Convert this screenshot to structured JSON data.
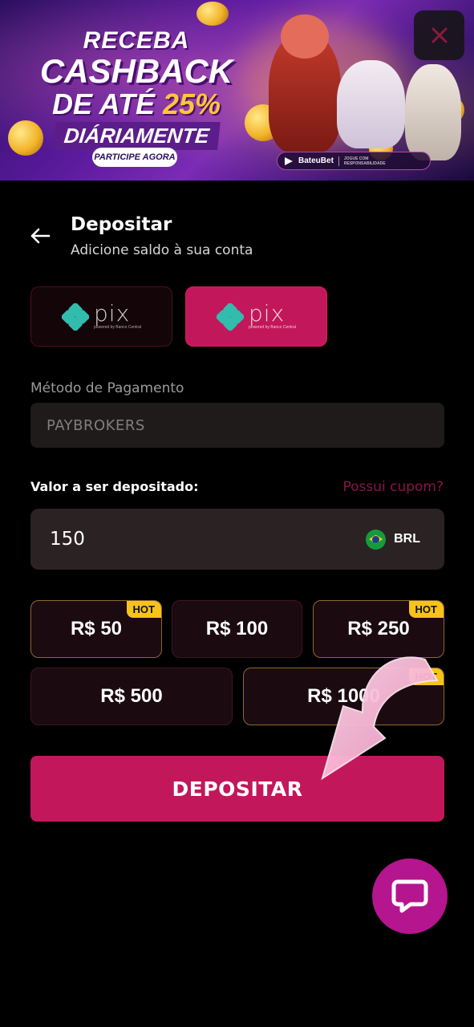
{
  "banner": {
    "line1": "RECEBA",
    "line2": "CASHBACK",
    "line3_prefix": "DE ATÉ ",
    "line3_highlight": "25%",
    "line4": "DIÁRIAMENTE",
    "cta": "PARTICIPE AGORA",
    "brand": "BateuBet",
    "disclaimer": "JOGUE COM RESPONSABILIDADE",
    "close_icon": "close-icon"
  },
  "header": {
    "back_icon": "arrow-left-icon",
    "title": "Depositar",
    "subtitle": "Adicione saldo à sua conta"
  },
  "payment_options": [
    {
      "label": "pix",
      "sub": "powered by Banco Central",
      "selected": false
    },
    {
      "label": "pix",
      "sub": "powered by Banco Central",
      "selected": true
    }
  ],
  "method": {
    "label": "Método de Pagamento",
    "value": "PAYBROKERS"
  },
  "amount": {
    "label": "Valor a ser depositado:",
    "coupon_link": "Possui cupom?",
    "value": "150",
    "currency": "BRL"
  },
  "quick_amounts": [
    {
      "label": "R$ 50",
      "hot": true
    },
    {
      "label": "R$ 100",
      "hot": false
    },
    {
      "label": "R$ 250",
      "hot": true
    },
    {
      "label": "R$ 500",
      "hot": false
    },
    {
      "label": "R$ 1000",
      "hot": true
    }
  ],
  "hot_label": "HOT",
  "deposit_button": "DEPOSITAR",
  "colors": {
    "primary": "#c2185b",
    "hot_badge": "#f7c21a",
    "chat": "#b5158e",
    "pix_teal": "#32bcad"
  },
  "chat_icon": "chat-bubble-icon"
}
